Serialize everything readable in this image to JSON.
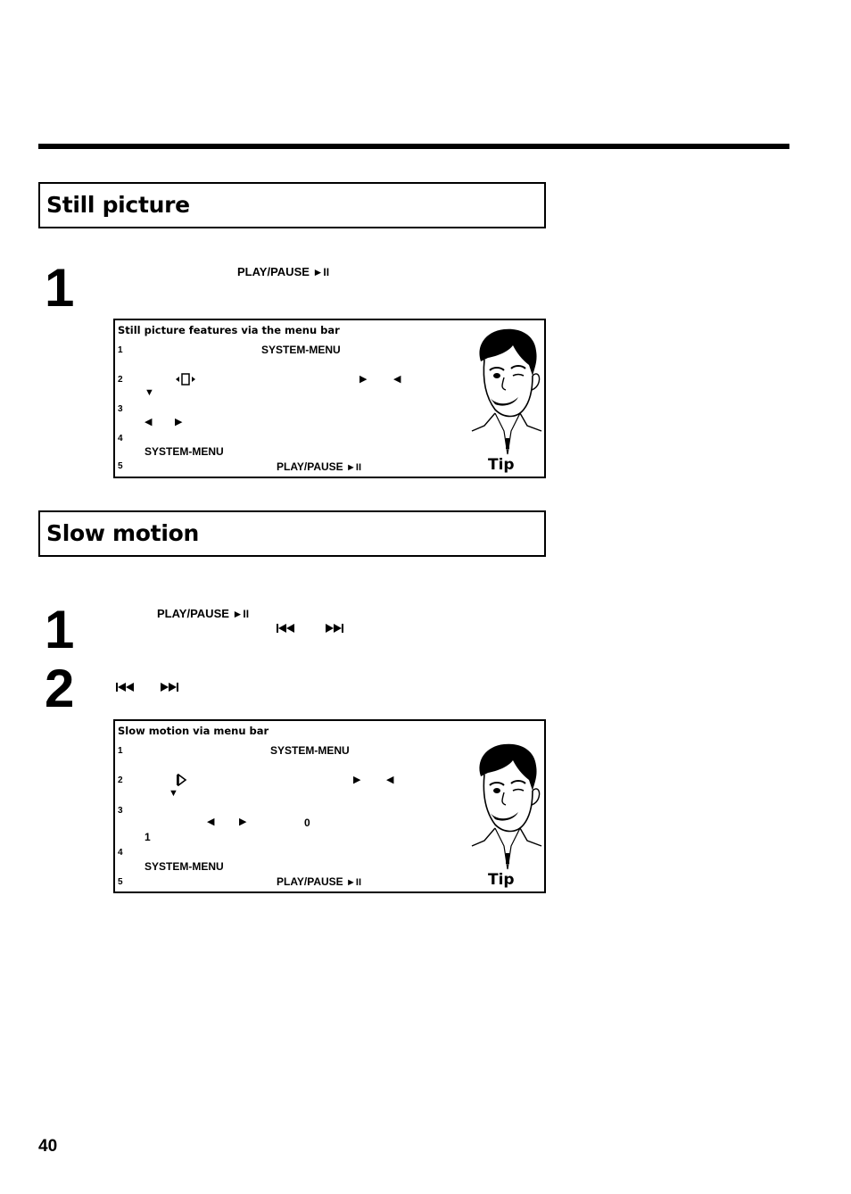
{
  "sections": [
    {
      "title": "Still picture",
      "steps": [
        {
          "number": "1",
          "key": "PLAY/PAUSE",
          "key_symbol": "►II"
        }
      ],
      "tip": {
        "title": "Still picture features via the menu bar",
        "items": [
          {
            "number": "1",
            "text": "SYSTEM-MENU"
          },
          {
            "number": "2",
            "icons": [
              "still-picture-icon",
              "right-arrow",
              "left-arrow",
              "down-arrow"
            ]
          },
          {
            "number": "3",
            "icons": [
              "left-arrow",
              "right-arrow"
            ]
          },
          {
            "number": "4",
            "text": "SYSTEM-MENU"
          },
          {
            "number": "5",
            "text": "PLAY/PAUSE",
            "key_symbol": "►II"
          }
        ],
        "label": "Tip"
      }
    },
    {
      "title": "Slow motion",
      "steps": [
        {
          "number": "1",
          "key": "PLAY/PAUSE",
          "key_symbol": "►II",
          "icons": [
            "previous-icon",
            "next-icon"
          ]
        },
        {
          "number": "2",
          "icons": [
            "previous-icon",
            "next-icon"
          ]
        }
      ],
      "tip": {
        "title": "Slow motion via menu bar",
        "items": [
          {
            "number": "1",
            "text": "SYSTEM-MENU"
          },
          {
            "number": "2",
            "icons": [
              "slow-motion-icon",
              "right-arrow",
              "left-arrow",
              "down-arrow"
            ]
          },
          {
            "number": "3",
            "icons": [
              "left-arrow",
              "right-arrow"
            ],
            "values": [
              "0",
              "1"
            ]
          },
          {
            "number": "4",
            "text": "SYSTEM-MENU"
          },
          {
            "number": "5",
            "text": "PLAY/PAUSE",
            "key_symbol": "►II"
          }
        ],
        "label": "Tip"
      }
    }
  ],
  "glyphs": {
    "right": "▶",
    "left": "◀",
    "down": "▼"
  },
  "page_number": "40"
}
